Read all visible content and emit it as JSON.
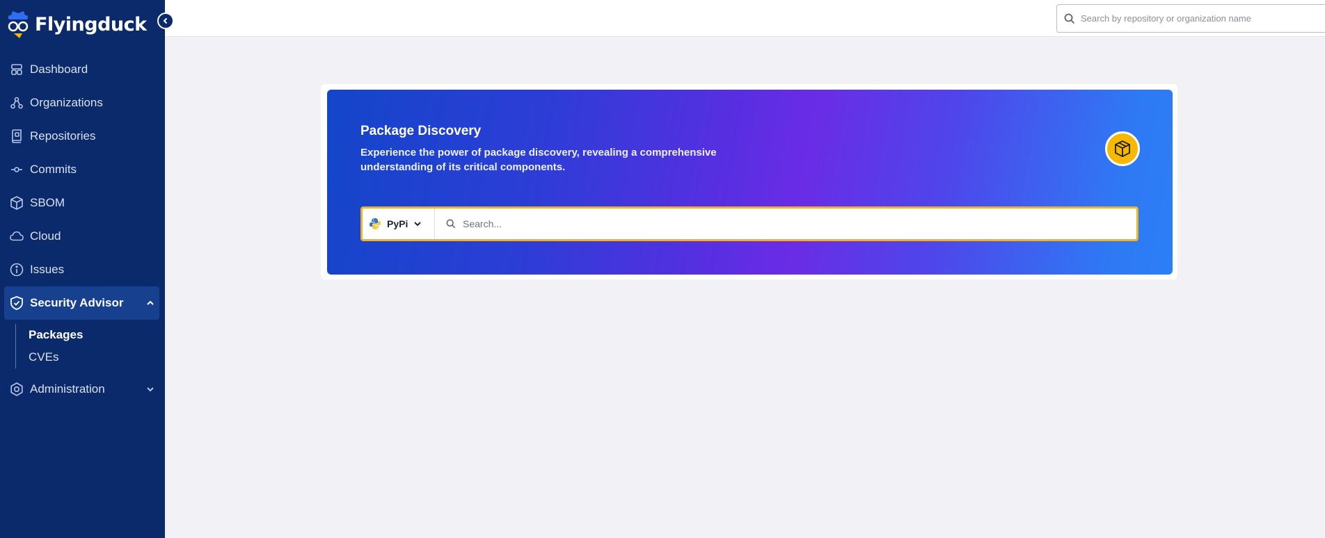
{
  "app": {
    "name": "Flyingduck"
  },
  "sidebar": {
    "items": [
      {
        "label": "Dashboard",
        "icon": "dashboard-icon"
      },
      {
        "label": "Organizations",
        "icon": "organizations-icon"
      },
      {
        "label": "Repositories",
        "icon": "repositories-icon"
      },
      {
        "label": "Commits",
        "icon": "commits-icon"
      },
      {
        "label": "SBOM",
        "icon": "sbom-icon"
      },
      {
        "label": "Cloud",
        "icon": "cloud-icon"
      },
      {
        "label": "Issues",
        "icon": "issues-icon"
      }
    ],
    "security_advisor": {
      "label": "Security Advisor",
      "icon": "shield-icon",
      "expanded": true,
      "children": [
        {
          "label": "Packages",
          "current": true
        },
        {
          "label": "CVEs",
          "current": false
        }
      ]
    },
    "administration": {
      "label": "Administration",
      "icon": "gear-icon",
      "expanded": false
    }
  },
  "header": {
    "search_placeholder": "Search by repository or organization name"
  },
  "hero": {
    "title": "Package Discovery",
    "description": "Experience the power of package discovery, revealing a comprehensive understanding of its critical components.",
    "ecosystem": "PyPi",
    "search_placeholder": "Search..."
  },
  "colors": {
    "sidebar_bg": "#0b2a6b",
    "active_item_bg": "#17408f",
    "accent_yellow": "#f6b800",
    "search_border": "#f0b325"
  }
}
